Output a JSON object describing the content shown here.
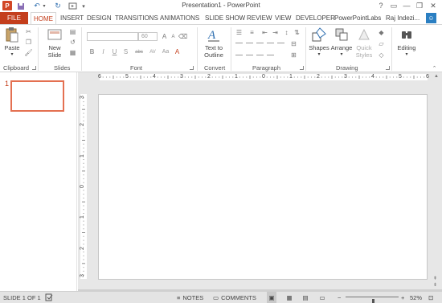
{
  "window": {
    "title": "Presentation1 - PowerPoint",
    "controls": [
      "?",
      "▭",
      "—",
      "❐",
      "✕"
    ]
  },
  "quick_access": [
    "save-icon",
    "undo-icon",
    "redo-icon",
    "start-from-beginning-icon",
    "customize-icon"
  ],
  "tabs": [
    "FILE",
    "HOME",
    "INSERT",
    "DESIGN",
    "TRANSITIONS",
    "ANIMATIONS",
    "SLIDE SHOW",
    "REVIEW",
    "VIEW",
    "DEVELOPER",
    "PowerPointLabs"
  ],
  "active_tab": "HOME",
  "user": {
    "name": "Raj Indezi...",
    "avatar": "☺"
  },
  "ribbon": {
    "clipboard": {
      "paste": "Paste",
      "label": "Clipboard"
    },
    "slides": {
      "new_slide": "New",
      "new_slide_2": "Slide",
      "label": "Slides"
    },
    "font": {
      "size": "60",
      "bold": "B",
      "italic": "I",
      "underline": "U",
      "strike": "S",
      "shadow": "abc",
      "spacing": "AV",
      "case": "Aa",
      "label": "Font"
    },
    "convert": {
      "text_to_outline": "Text to",
      "text_to_outline_2": "Outline",
      "label": "Convert"
    },
    "paragraph": {
      "label": "Paragraph"
    },
    "drawing": {
      "shapes": "Shapes",
      "arrange": "Arrange",
      "quick_styles": "Quick",
      "quick_styles_2": "Styles",
      "label": "Drawing"
    },
    "editing": {
      "editing": "Editing"
    }
  },
  "slides": [
    {
      "number": "1"
    }
  ],
  "rulers": {
    "horizontal": [
      "6",
      "5",
      "4",
      "3",
      "2",
      "1",
      "0",
      "1",
      "2",
      "3",
      "4",
      "5",
      "6"
    ],
    "vertical": [
      "3",
      "2",
      "1",
      "0",
      "1",
      "2",
      "3"
    ]
  },
  "status": {
    "slide": "SLIDE 1 OF 1",
    "notes": "NOTES",
    "comments": "COMMENTS",
    "zoom": "52%",
    "zoom_fraction": 0.52
  },
  "colors": {
    "accent": "#c43e1c",
    "thumbnail_border": "#e47051",
    "canvas_bg": "#e7e7e7"
  }
}
